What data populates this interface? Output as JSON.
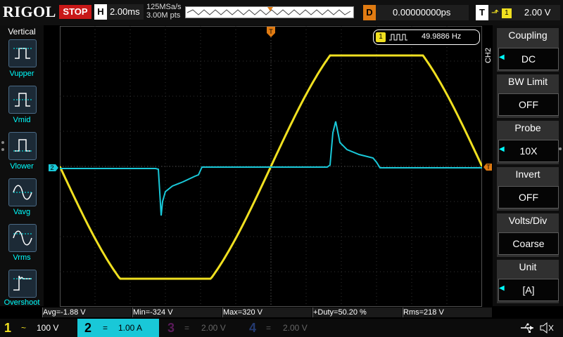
{
  "header": {
    "logo": "RIGOL",
    "run_state": "STOP",
    "h_key": "H",
    "timebase": "2.00ms",
    "sample_rate": "125MSa/s",
    "memory_depth": "3.00M pts",
    "d_key": "D",
    "delay": "0.00000000ps",
    "t_key": "T",
    "trigger_source": "1",
    "trigger_level": "2.00 V"
  },
  "left_panel": {
    "title": "Vertical",
    "items": [
      {
        "label": "Vupper"
      },
      {
        "label": "Vmid"
      },
      {
        "label": "Vlower"
      },
      {
        "label": "Vavg"
      },
      {
        "label": "Vrms"
      },
      {
        "label": "Overshoot"
      }
    ]
  },
  "right_panel": {
    "channel_label": "CH2",
    "items": [
      {
        "title": "Coupling",
        "value": "DC"
      },
      {
        "title": "BW Limit",
        "value": "OFF"
      },
      {
        "title": "Probe",
        "value": "10X"
      },
      {
        "title": "Invert",
        "value": "OFF"
      },
      {
        "title": "Volts/Div",
        "value": "Coarse"
      },
      {
        "title": "Unit",
        "value": "[A]"
      }
    ]
  },
  "frequency_counter": {
    "channel": "1",
    "value": "49.9886 Hz"
  },
  "markers": {
    "trigger_top": "T",
    "ch2_offset": "2",
    "trigger_level": "T"
  },
  "measurements": [
    {
      "text": "Avg=-1.88 V"
    },
    {
      "text": "Min=-324 V"
    },
    {
      "text": "Max=320 V"
    },
    {
      "text": "+Duty=50.20 %"
    },
    {
      "text": "Rms=218 V"
    }
  ],
  "channels": [
    {
      "num": "1",
      "coupling_icon": "~",
      "scale": "100 V",
      "color": "#f0e020"
    },
    {
      "num": "2",
      "coupling_icon": "=",
      "scale": "1.00 A",
      "color": "#19c8d8"
    },
    {
      "num": "3",
      "coupling_icon": "=",
      "scale": "2.00 V",
      "color": "#b020b0"
    },
    {
      "num": "4",
      "coupling_icon": "=",
      "scale": "2.00 V",
      "color": "#3060d0"
    }
  ],
  "colors": {
    "ch1": "#f0e020",
    "ch2": "#19c8d8",
    "stop": "#c81818",
    "trigger": "#e07b12"
  },
  "icons": [
    "usb-icon",
    "speaker-mute-icon"
  ]
}
